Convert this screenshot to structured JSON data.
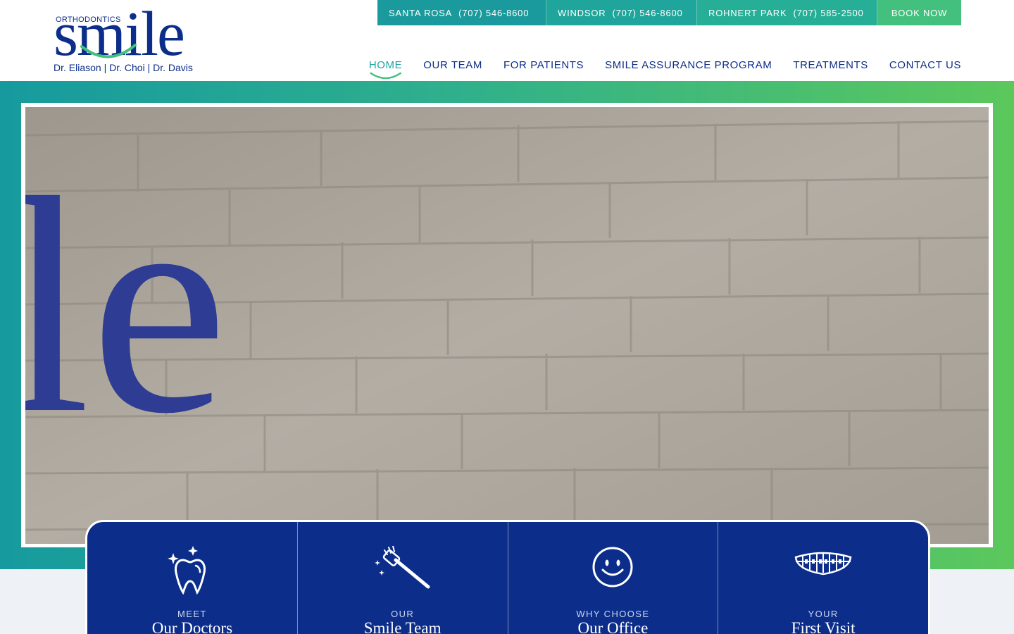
{
  "brand": {
    "top_label": "ORTHODONTICS",
    "name": "smile",
    "doctors": "Dr. Eliason | Dr. Choi | Dr. Davis",
    "primary_color": "#0c2e8a",
    "accent_color": "#43c07e",
    "teal_color": "#1a9a9c"
  },
  "locations": [
    {
      "name": "SANTA ROSA",
      "phone": "(707) 546-8600"
    },
    {
      "name": "WINDSOR",
      "phone": "(707) 546-8600"
    },
    {
      "name": "ROHNERT PARK",
      "phone": "(707) 585-2500"
    }
  ],
  "book_now": "BOOK NOW",
  "nav": [
    {
      "label": "HOME",
      "active": true
    },
    {
      "label": "OUR TEAM"
    },
    {
      "label": "FOR PATIENTS"
    },
    {
      "label": "SMILE ASSURANCE PROGRAM"
    },
    {
      "label": "TREATMENTS"
    },
    {
      "label": "CONTACT US"
    }
  ],
  "hero": {
    "photo_signage": "le"
  },
  "cards": [
    {
      "kicker": "MEET",
      "title": "Our Doctors",
      "icon": "sparkling-tooth-icon"
    },
    {
      "kicker": "OUR",
      "title": "Smile Team",
      "icon": "toothbrush-icon"
    },
    {
      "kicker": "WHY CHOOSE",
      "title": "Our Office",
      "icon": "smiley-face-icon"
    },
    {
      "kicker": "YOUR",
      "title": "First Visit",
      "icon": "braces-icon"
    }
  ]
}
